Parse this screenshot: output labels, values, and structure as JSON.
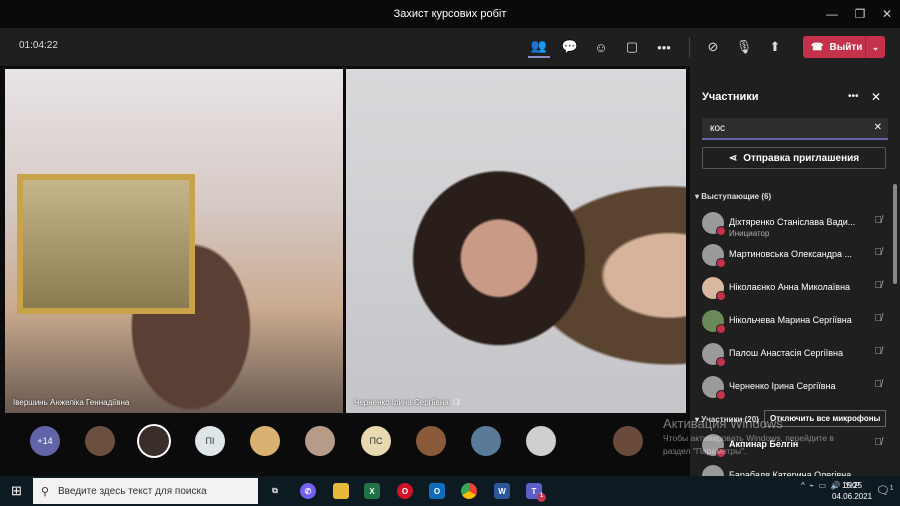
{
  "window": {
    "title": "Захист курсових робіт"
  },
  "toolbar": {
    "timer": "01:04:22",
    "leave_label": "Выйти"
  },
  "videos": [
    {
      "name": "Івершинь Анжеліка Геннадіївна"
    },
    {
      "name": "Черненко Ірина Сергіївна"
    }
  ],
  "strip": {
    "overflow": "+14",
    "initials": [
      "ПІ",
      "ПС"
    ]
  },
  "panel": {
    "title": "Участники",
    "search_value": "кос",
    "invite_label": "Отправка приглашения",
    "presenters_header": "Выступающие (6)",
    "presenters": [
      {
        "name": "Діхтяренко Станіслава Вади...",
        "role": "Инициатор"
      },
      {
        "name": "Мартиновська Олександра ..."
      },
      {
        "name": "Ніколаєнко Анна Миколаївна"
      },
      {
        "name": "Нікольчева Марина Сергіївна"
      },
      {
        "name": "Палош Анастасія Сергіївна"
      },
      {
        "name": "Черненко Ірина Сергіївна"
      }
    ],
    "attendees_header": "Участники (20)",
    "mute_all_label": "Отключить все микрофоны",
    "attendees": [
      {
        "name": "Акпинар Белгін"
      },
      {
        "name": "Барабаля Катерина Олегівна"
      }
    ]
  },
  "activation": {
    "title": "Активация Windows",
    "line1": "Чтобы активировать Windows, перейдите в",
    "line2": "раздел \"Параметры\"."
  },
  "taskbar": {
    "search_placeholder": "Введите здесь текст для поиска",
    "lang": "УКР",
    "time": "15:25",
    "date": "04.06.2021",
    "teams_badge": "1",
    "notif_badge": "1"
  }
}
